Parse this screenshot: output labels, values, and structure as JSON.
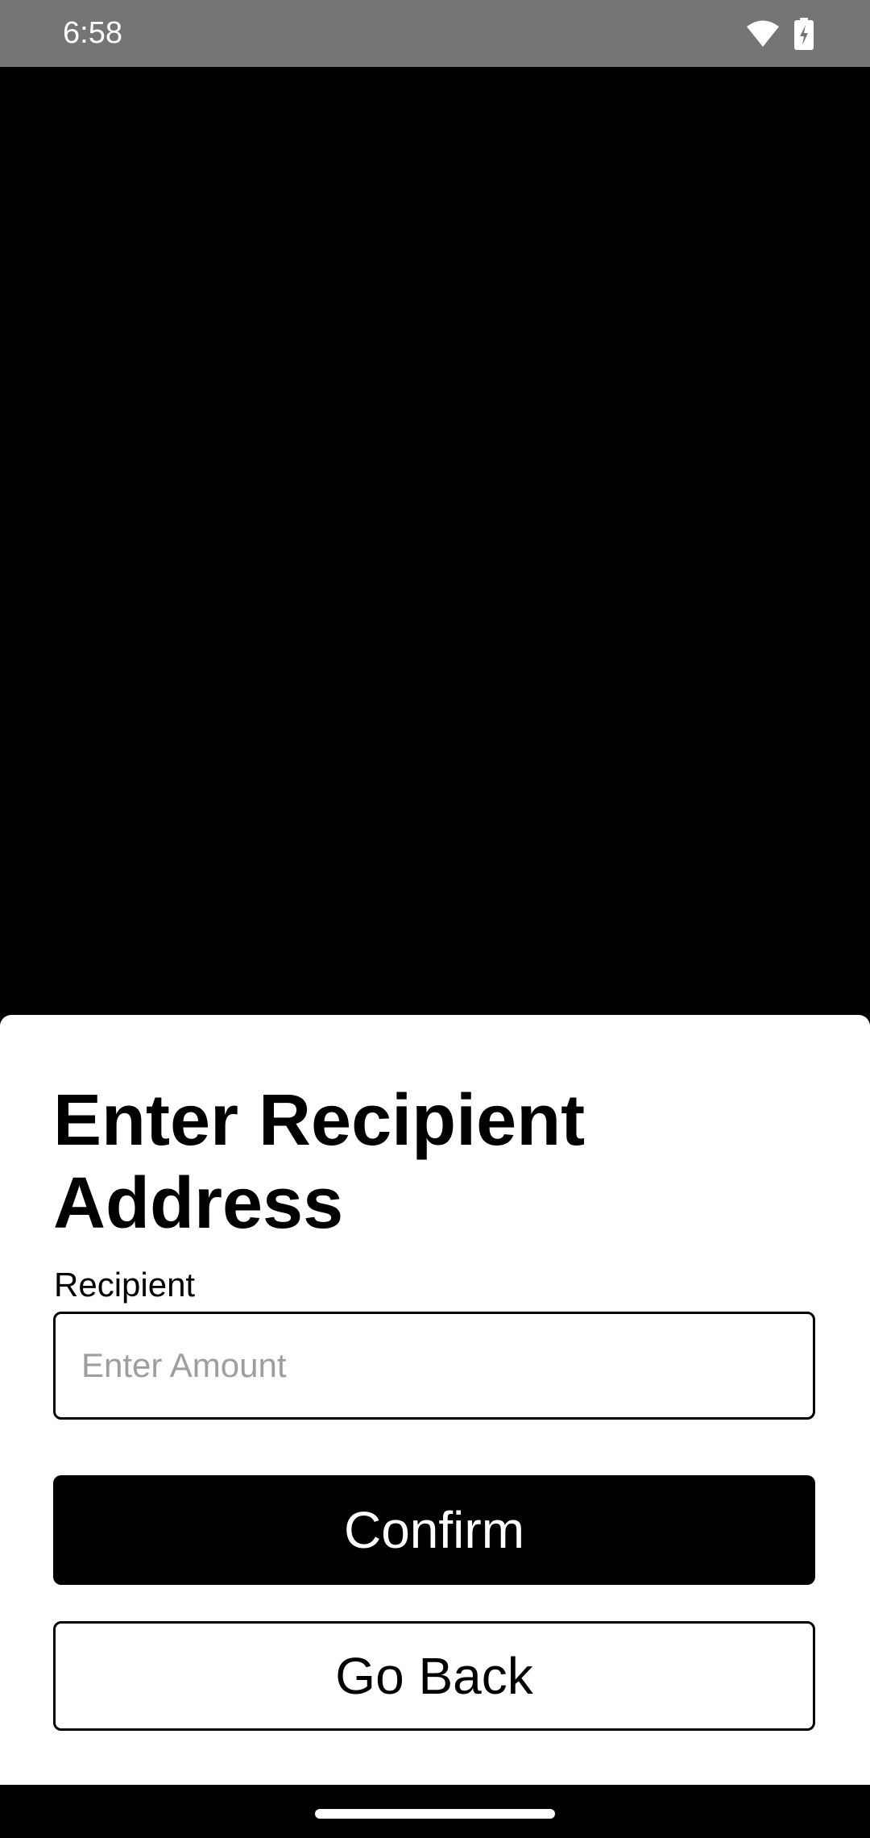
{
  "status_bar": {
    "time": "6:58",
    "icons": [
      "wifi-icon",
      "battery-charging-icon"
    ]
  },
  "sheet": {
    "title": "Enter Recipient Address",
    "recipient_label": "Recipient",
    "recipient_input": {
      "value": "",
      "placeholder": "Enter Amount"
    },
    "confirm_label": "Confirm",
    "go_back_label": "Go Back"
  },
  "colors": {
    "status_bar_bg": "#757575",
    "backdrop": "#000000",
    "sheet_bg": "#ffffff",
    "primary_button_bg": "#000000",
    "placeholder_text": "#9e9e9e"
  }
}
